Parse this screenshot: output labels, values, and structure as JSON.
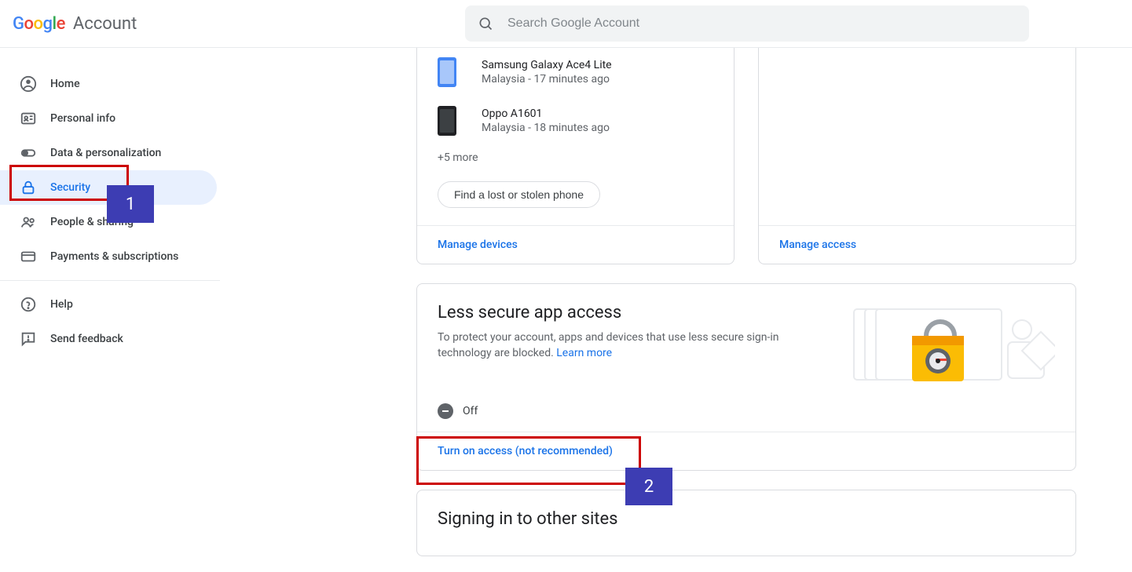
{
  "header": {
    "logo_letters": [
      "G",
      "o",
      "o",
      "g",
      "l",
      "e"
    ],
    "account_label": "Account",
    "search_placeholder": "Search Google Account"
  },
  "sidebar": {
    "items": [
      {
        "icon": "user-circle-icon",
        "label": "Home"
      },
      {
        "icon": "id-card-icon",
        "label": "Personal info"
      },
      {
        "icon": "toggle-icon",
        "label": "Data & personalization"
      },
      {
        "icon": "lock-icon",
        "label": "Security"
      },
      {
        "icon": "people-icon",
        "label": "People & sharing"
      },
      {
        "icon": "card-icon",
        "label": "Payments & subscriptions"
      }
    ],
    "secondary": [
      {
        "icon": "help-icon",
        "label": "Help"
      },
      {
        "icon": "feedback-icon",
        "label": "Send feedback"
      }
    ]
  },
  "devices_card": {
    "rows": [
      {
        "name": "Samsung Galaxy Ace4 Lite",
        "meta": "Malaysia - 17 minutes ago",
        "thumb": "blue"
      },
      {
        "name": "Oppo A1601",
        "meta": "Malaysia - 18 minutes ago",
        "thumb": "dark"
      }
    ],
    "more": "+5 more",
    "pill_label": "Find a lost or stolen phone",
    "footer": "Manage devices"
  },
  "access_card": {
    "footer": "Manage access"
  },
  "lsa_card": {
    "title": "Less secure app access",
    "desc": "To protect your account, apps and devices that use less secure sign-in technology are blocked. ",
    "learn_more": "Learn more",
    "status": "Off",
    "footer": "Turn on access (not recommended)"
  },
  "signing_card": {
    "title": "Signing in to other sites"
  },
  "annotations": {
    "badge1": "1",
    "badge2": "2"
  }
}
